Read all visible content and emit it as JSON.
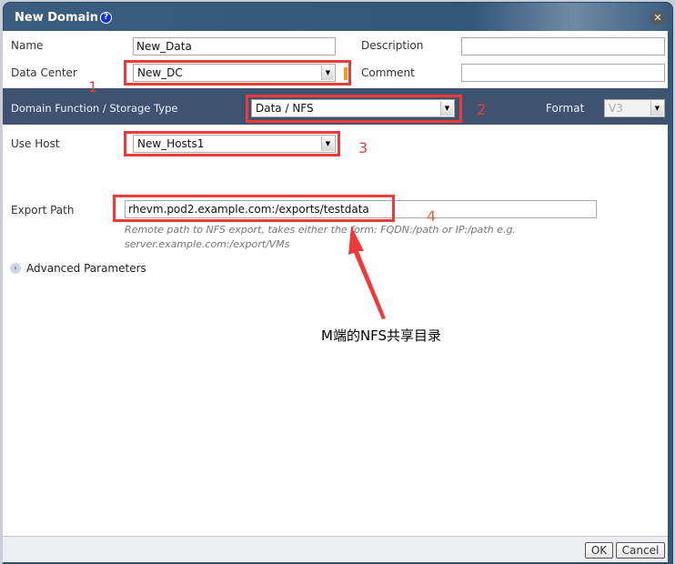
{
  "dialog": {
    "title": "New Domain",
    "help_icon": "help-icon",
    "close_icon": "close-icon"
  },
  "form": {
    "name": {
      "label": "Name",
      "value": "New_Data"
    },
    "description": {
      "label": "Description",
      "value": ""
    },
    "data_center": {
      "label": "Data Center",
      "value": "New_DC"
    },
    "comment": {
      "label": "Comment",
      "value": ""
    },
    "domain_function": {
      "label": "Domain Function / Storage Type",
      "value": "Data / NFS"
    },
    "format": {
      "label": "Format",
      "value": "V3"
    },
    "use_host": {
      "label": "Use Host",
      "value": "New_Hosts1"
    },
    "export_path": {
      "label": "Export Path",
      "value": "rhevm.pod2.example.com:/exports/testdata",
      "hint_line1": "Remote path to NFS export, takes either the form: FQDN:/path or IP:/path e.g.",
      "hint_line2": "server.example.com:/export/VMs"
    },
    "advanced": {
      "label": "Advanced Parameters"
    }
  },
  "annotations": {
    "n1": "1",
    "n2": "2",
    "n3": "3",
    "n4": "4",
    "note": "M端的NFS共享目录",
    "color": "#f03a3a"
  },
  "footer": {
    "ok": "OK",
    "cancel": "Cancel"
  }
}
